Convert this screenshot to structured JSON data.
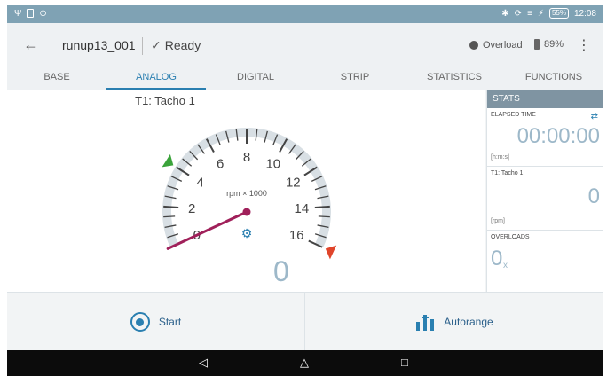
{
  "status_bar": {
    "time": "12:08",
    "battery_badge": "55%",
    "left_icons": [
      "usb-icon",
      "image-icon",
      "info-icon"
    ],
    "right_icons": [
      "bluetooth-icon",
      "sync-icon",
      "wifi-icon",
      "charging-icon"
    ]
  },
  "header": {
    "title": "runup13_001",
    "status": "Ready",
    "overload_label": "Overload",
    "battery_level": "89%"
  },
  "tabs": [
    {
      "label": "BASE",
      "active": false
    },
    {
      "label": "ANALOG",
      "active": true
    },
    {
      "label": "DIGITAL",
      "active": false
    },
    {
      "label": "STRIP",
      "active": false
    },
    {
      "label": "STATISTICS",
      "active": false
    },
    {
      "label": "FUNCTIONS",
      "active": false
    }
  ],
  "gauge": {
    "title": "T1: Tacho 1",
    "unit": "rpm × 1000",
    "ticks": [
      "0",
      "2",
      "4",
      "6",
      "8",
      "10",
      "12",
      "14",
      "16"
    ],
    "min": 0,
    "max": 16,
    "needle_value": 0,
    "low_marker_value": 4,
    "high_marker_value": 16,
    "value": "0",
    "colors": {
      "needle": "#a0205a",
      "low_marker": "#3aa33a",
      "high_marker": "#e0452b",
      "arc": "#d8dfe4"
    }
  },
  "stats": {
    "header": "STATS",
    "elapsed_label": "ELAPSED TIME",
    "elapsed_value": "00:00:00",
    "elapsed_unit": "[h:m:s]",
    "channel_label": "T1: Tacho 1",
    "channel_value": "0",
    "channel_unit": "[rpm]",
    "overloads_label": "OVERLOADS",
    "overloads_value": "0",
    "overloads_sub": "x"
  },
  "actions": {
    "start_label": "Start",
    "autorange_label": "Autorange"
  },
  "nav": {
    "back_glyph": "◁",
    "home_glyph": "△",
    "recents_glyph": "□"
  },
  "colors": {
    "accent": "#2a7fb0",
    "statusbar": "#7fa2b4",
    "stats_header": "#7f94a2"
  }
}
